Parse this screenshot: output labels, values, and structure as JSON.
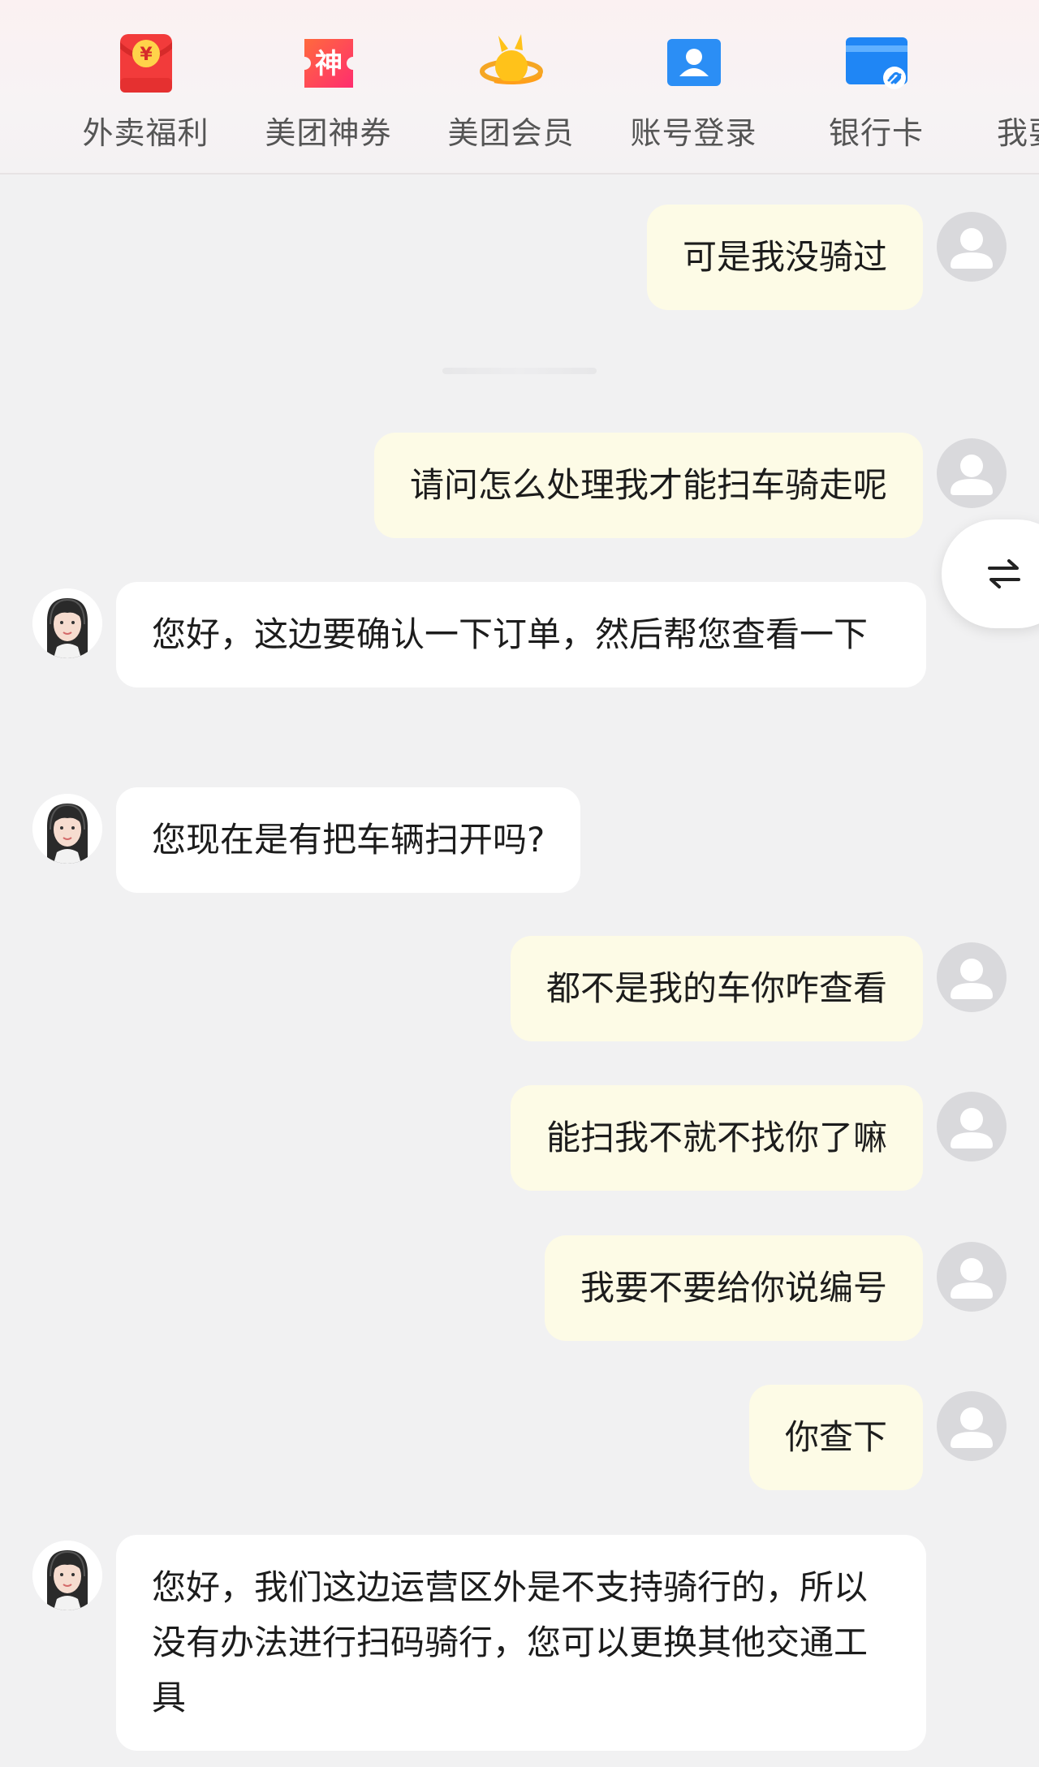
{
  "quick_actions": [
    {
      "label": "外卖福利",
      "icon": "red-packet-icon"
    },
    {
      "label": "美团神券",
      "icon": "coupon-icon"
    },
    {
      "label": "美团会员",
      "icon": "kangaroo-planet-icon"
    },
    {
      "label": "账号登录",
      "icon": "account-icon"
    },
    {
      "label": "银行卡",
      "icon": "bank-card-link-icon"
    },
    {
      "label": "我要",
      "icon": "more-icon"
    }
  ],
  "coupon_glyph": "神",
  "yuan_glyph": "¥",
  "switch_icon": "swap-arrows-icon",
  "messages": [
    {
      "from": "user",
      "text": "可是我没骑过"
    },
    {
      "from": "user",
      "text": "请问怎么处理我才能扫车骑走呢"
    },
    {
      "from": "agent",
      "text": "您好，这边要确认一下订单，然后帮您查看一下"
    },
    {
      "from": "agent",
      "text": "您现在是有把车辆扫开吗?"
    },
    {
      "from": "user",
      "text": "都不是我的车你咋查看"
    },
    {
      "from": "user",
      "text": "能扫我不就不找你了嘛"
    },
    {
      "from": "user",
      "text": "我要不要给你说编号"
    },
    {
      "from": "user",
      "text": "你查下"
    },
    {
      "from": "agent",
      "text": "您好，我们这边运营区外是不支持骑行的，所以没有办法进行扫码骑行，您可以更换其他交通工具"
    }
  ],
  "colors": {
    "user_bubble": "#fdfbe6",
    "agent_bubble": "#ffffff",
    "background": "#f1f1f2",
    "accent_red": "#ff3b3b",
    "accent_blue": "#1f86f5"
  }
}
